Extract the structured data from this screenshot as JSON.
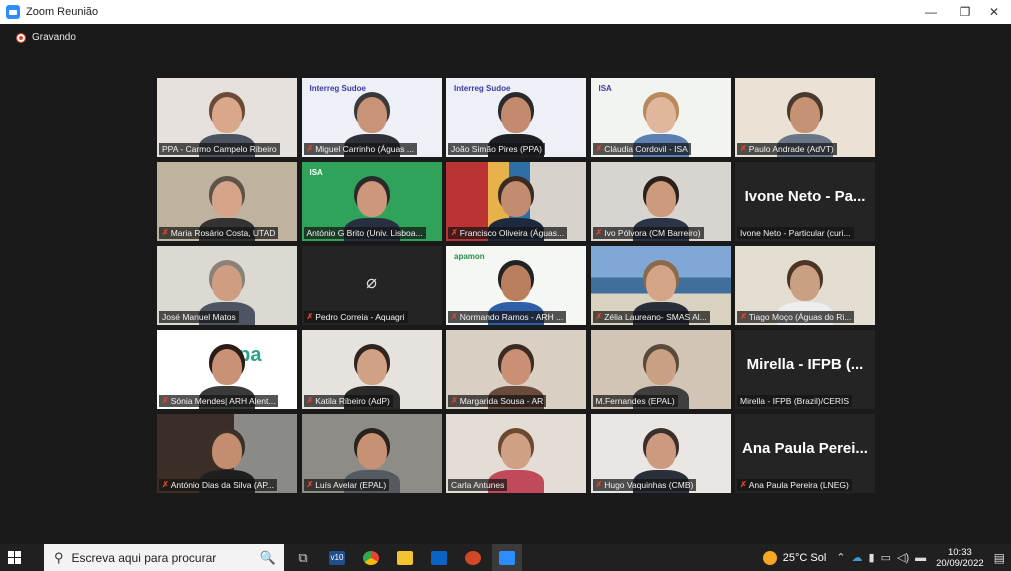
{
  "window": {
    "title": "Zoom Reunião",
    "accent": "#2d8cff"
  },
  "recording": {
    "label": "Gravando",
    "color": "#e0442d"
  },
  "tiles": [
    {
      "name": "PPA - Carmo Campelo Ribeiro",
      "muted": false,
      "kind": "video",
      "scene": "plain",
      "wall": "#e6e1dc",
      "skin": "#d9a78a",
      "hair": "#6b4a37",
      "shirt": "#4b5260"
    },
    {
      "name": "Miguel Carrinho (Águas ...",
      "muted": true,
      "kind": "slide",
      "brand": "Interreg Sudoe",
      "skin": "#c99378",
      "hair": "#3a3a3a",
      "shirt": "#2f2f3a"
    },
    {
      "name": "João Simão Pires (PPA)",
      "muted": false,
      "kind": "slide",
      "active": true,
      "brand": "Interreg Sudoe",
      "skin": "#c38a6d",
      "hair": "#2a2a2a",
      "shirt": "#1f1f26"
    },
    {
      "name": "Cláudia Cordovil - ISA",
      "muted": true,
      "kind": "isa",
      "brand": "ISA",
      "skin": "#e0b79c",
      "hair": "#b8895c",
      "shirt": "#5a7fb0"
    },
    {
      "name": "Paulo Andrade (AdVT)",
      "muted": true,
      "kind": "video",
      "scene": "office",
      "wall": "#e9e2d5",
      "skin": "#c69274",
      "hair": "#4a3a2e",
      "shirt": "#6a7688"
    },
    {
      "name": "Maria Rosário Costa, UTAD",
      "muted": true,
      "kind": "video",
      "scene": "plain",
      "wall": "#bfb29e",
      "skin": "#d6a488",
      "hair": "#5e5349",
      "shirt": "#333"
    },
    {
      "name": "António G Brito (Univ. Lisboa...",
      "muted": false,
      "kind": "isa-green",
      "brand": "ISA",
      "skin": "#cc977a",
      "hair": "#2a2a2a",
      "shirt": "#263040"
    },
    {
      "name": "Francisco Oliveira (Águas...",
      "muted": true,
      "kind": "video",
      "scene": "colorful",
      "wall": "#7a2a2a",
      "skin": "#c48c6f",
      "hair": "#3b2c23",
      "shirt": "#1d2a3d"
    },
    {
      "name": "Ivo Pólvora (CM Barreiro)",
      "muted": true,
      "kind": "video",
      "scene": "office",
      "wall": "#d8d4cf",
      "skin": "#cc9a7c",
      "hair": "#2a211c",
      "shirt": "#2b3548"
    },
    {
      "name": "Ivone Neto - Particular (curi...",
      "muted": false,
      "kind": "text",
      "big": "Ivone Neto - Pa..."
    },
    {
      "name": "José Manuel Matos",
      "muted": false,
      "kind": "video",
      "scene": "plain",
      "wall": "#dcd8d2",
      "skin": "#cf9d81",
      "hair": "#8a8278",
      "shirt": "#4d5563"
    },
    {
      "name": "Pedro Correia - Aquagri",
      "muted": true,
      "kind": "camoff"
    },
    {
      "name": "Normando Ramos - ARH ...",
      "muted": true,
      "kind": "slide-green",
      "brand": "apamon",
      "skin": "#b87e5e",
      "hair": "#222",
      "shirt": "#2f5fa8"
    },
    {
      "name": "Zélia Laureano- SMAS Al...",
      "muted": true,
      "kind": "video",
      "scene": "coast",
      "wall": "#6f98c2",
      "skin": "#d4a486",
      "hair": "#8a6a4a",
      "shirt": "#2a2e3a"
    },
    {
      "name": "Tiago Moço (Águas do Ri...",
      "muted": true,
      "kind": "video",
      "scene": "office",
      "wall": "#e4ddd2",
      "skin": "#caa083",
      "hair": "#4a3526",
      "shirt": "#eeeeee"
    },
    {
      "name": "Sónia Mendes| ARH Alent...",
      "muted": true,
      "kind": "apa",
      "brand": "apa",
      "skin": "#c99276",
      "hair": "#2a1d17",
      "shirt": "#3a3a3a"
    },
    {
      "name": "Katila Ribeiro (AdP)",
      "muted": true,
      "kind": "video",
      "scene": "plain",
      "wall": "#e6e3de",
      "skin": "#d1a185",
      "hair": "#2e2420",
      "shirt": "#2a2a2a"
    },
    {
      "name": "Margarida Sousa - AR",
      "muted": true,
      "kind": "video",
      "scene": "room",
      "wall": "#d9cfc2",
      "skin": "#c99073",
      "hair": "#3a2a22",
      "shirt": "#6a4a3a"
    },
    {
      "name": "M.Fernandes (EPAL)",
      "muted": false,
      "kind": "video",
      "scene": "room",
      "wall": "#d2c5b5",
      "skin": "#caa084",
      "hair": "#5a4a3a",
      "shirt": "#3f3f3f"
    },
    {
      "name": "Mirella - IFPB (Brazil)/CERIS",
      "muted": false,
      "kind": "text",
      "big": "Mirella - IFPB (..."
    },
    {
      "name": "António Dias da Silva (AP...",
      "muted": true,
      "kind": "video",
      "scene": "dark",
      "wall": "#5a4a3e",
      "skin": "#c48d6f",
      "hair": "#3a302a",
      "shirt": "#1f1f1f"
    },
    {
      "name": "Luís Avelar (EPAL)",
      "muted": true,
      "kind": "video",
      "scene": "plain",
      "wall": "#8e8c86",
      "skin": "#c79174",
      "hair": "#2a221e",
      "shirt": "#555a60"
    },
    {
      "name": "Carla Antunes",
      "muted": false,
      "kind": "video",
      "scene": "room",
      "wall": "#e3ddd5",
      "skin": "#d0a084",
      "hair": "#6a4a32",
      "shirt": "#c04a5a"
    },
    {
      "name": "Hugo Vaquinhas (CMB)",
      "muted": true,
      "kind": "video",
      "scene": "plain",
      "wall": "#e9e6e4",
      "skin": "#cc9a7e",
      "hair": "#3a2f2a",
      "shirt": "#2a2f3a"
    },
    {
      "name": "Ana Paula Pereira (LNEG)",
      "muted": true,
      "kind": "text",
      "big": "Ana Paula Perei..."
    }
  ],
  "taskbar": {
    "search_placeholder": "Escreva aqui para procurar",
    "weather": "25°C Sol",
    "time": "10:33",
    "date": "20/09/2022",
    "apps": [
      "task-view-icon",
      "v10-app-icon",
      "chrome-icon",
      "file-explorer-icon",
      "outlook-icon",
      "powerpoint-icon",
      "zoom-icon"
    ]
  }
}
